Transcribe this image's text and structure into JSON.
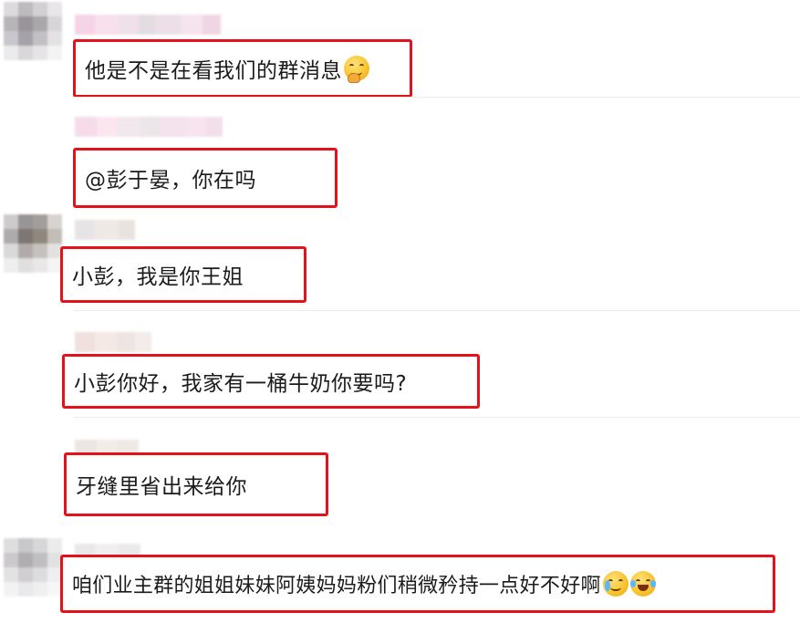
{
  "messages": [
    {
      "text": "他是不是在看我们的群消息",
      "emoji": "thinking-emoji"
    },
    {
      "text": "@彭于晏，你在吗"
    },
    {
      "text": "小彭，我是你王姐"
    },
    {
      "text": "小彭你好，我家有一桶牛奶你要吗?"
    },
    {
      "text": "牙缝里省出来给你"
    },
    {
      "text": "咱们业主群的姐姐妹妹阿姨妈妈粉们稍微矜持一点好不好啊",
      "emojis": [
        "crying-emoji",
        "laughing-tears-emoji"
      ]
    }
  ],
  "colors": {
    "highlight_border": "#e5121b",
    "background": "#ffffff",
    "text": "#1b1b1b"
  }
}
